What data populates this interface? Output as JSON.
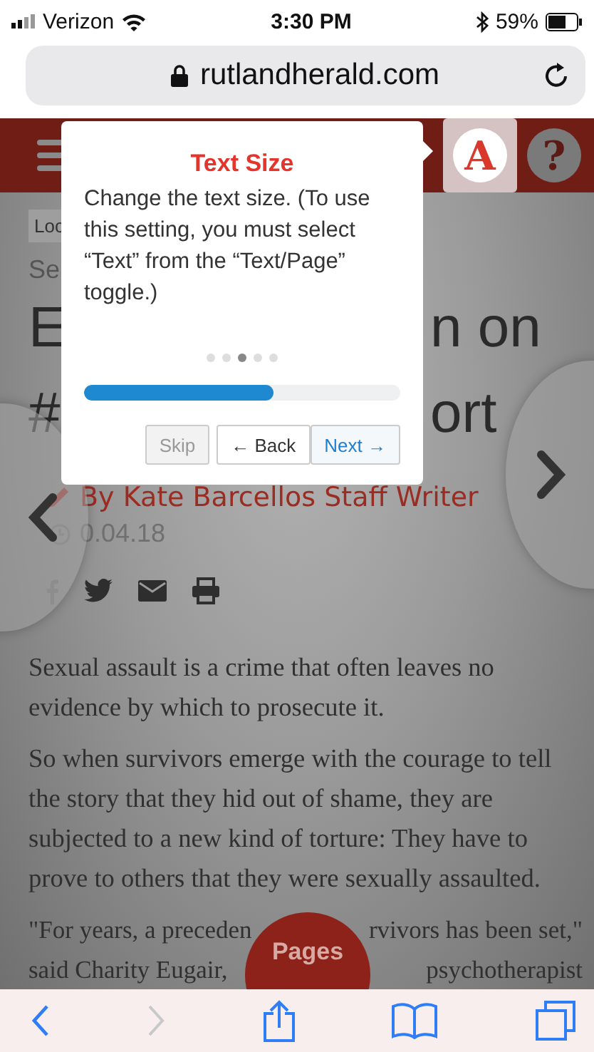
{
  "status_bar": {
    "carrier": "Verizon",
    "time": "3:30 PM",
    "battery": "59%"
  },
  "address_bar": {
    "url": "rutlandherald.com"
  },
  "site_header": {
    "buttons": [
      {
        "kind": "menu"
      },
      {
        "kind": "text_size",
        "label": "A",
        "selected": true
      },
      {
        "kind": "help",
        "label": "?",
        "selected": false
      }
    ]
  },
  "article": {
    "tag": "Loc",
    "section": "Se",
    "headline_lines": [
      {
        "left": "E",
        "right": "n on"
      },
      {
        "left": "#",
        "right": "ort"
      }
    ],
    "byline": "By Kate Barcellos Staff Writer",
    "date": "0.04.18",
    "paragraphs": [
      "Sexual assault is a crime that often leaves no evidence by which to prosecute it.",
      "So when survivors emerge with the courage to tell the story that they hid out of shame, they are subjected to a new kind of torture: They have to prove to others that they were sexually assaulted."
    ],
    "partial_lines": [
      {
        "left": "\"For years, a preceden",
        "right": "rvivors has been set,\""
      },
      {
        "left": "said Charity Eugair,",
        "right": "psychotherapist"
      }
    ]
  },
  "tour_popover": {
    "title": "Text Size",
    "body": "Change the text size. (To use this setting, you must select “Text” from the “Text/Page” toggle.)",
    "steps": [
      {
        "selected": false
      },
      {
        "selected": false
      },
      {
        "selected": true
      },
      {
        "selected": false
      },
      {
        "selected": false
      }
    ],
    "level": 0.6,
    "buttons": [
      {
        "kind": "skip",
        "label": "Skip",
        "disabled": true
      },
      {
        "kind": "back",
        "label": "← Back",
        "disabled": false
      },
      {
        "kind": "next",
        "label": "Next →",
        "disabled": false
      }
    ]
  },
  "pages_button": {
    "label": "Pages"
  },
  "toolbar": {
    "buttons": [
      {
        "kind": "back",
        "disabled": false
      },
      {
        "kind": "forward",
        "disabled": true
      },
      {
        "kind": "share",
        "disabled": false
      },
      {
        "kind": "bookmarks",
        "disabled": false
      },
      {
        "kind": "tabs",
        "disabled": false
      }
    ]
  }
}
